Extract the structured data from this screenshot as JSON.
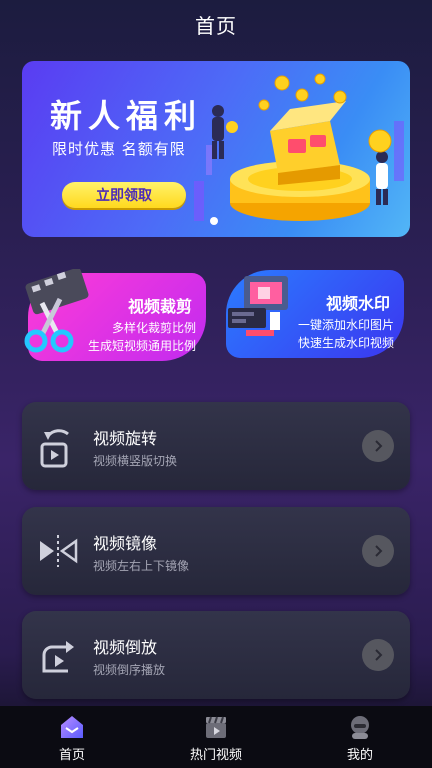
{
  "header": {
    "title": "首页"
  },
  "banner": {
    "headline": "新人福利",
    "subline": "限时优惠  名额有限",
    "cta": "立即领取"
  },
  "features": [
    {
      "title": "视频裁剪",
      "line1": "多样化裁剪比例",
      "line2": "生成短视频通用比例"
    },
    {
      "title": "视频水印",
      "line1": "一键添加水印图片",
      "line2": "快速生成水印视频"
    }
  ],
  "items": [
    {
      "title": "视频旋转",
      "subtitle": "视频横竖版切换",
      "icon": "rotate-video-icon"
    },
    {
      "title": "视频镜像",
      "subtitle": "视频左右上下镜像",
      "icon": "mirror-icon"
    },
    {
      "title": "视频倒放",
      "subtitle": "视频倒序播放",
      "icon": "reverse-play-icon"
    }
  ],
  "tabs": [
    {
      "label": "首页",
      "icon": "home-icon"
    },
    {
      "label": "热门视频",
      "icon": "clapperboard-icon"
    },
    {
      "label": "我的",
      "icon": "profile-icon"
    }
  ],
  "colors": {
    "accent_yellow": "#ffd91e",
    "crop_card": "#e436e6",
    "watermark_card": "#2f5cf6",
    "tab_active": "#7c5cff"
  }
}
